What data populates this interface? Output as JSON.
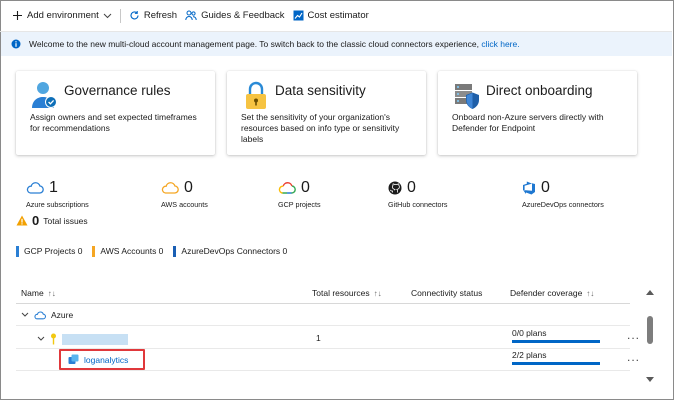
{
  "toolbar": {
    "add_environment": "Add environment",
    "refresh": "Refresh",
    "guides": "Guides & Feedback",
    "cost_estimator": "Cost estimator"
  },
  "banner": {
    "text": "Welcome to the new multi-cloud account management page. To switch back to the classic cloud connectors experience, ",
    "link": "click here."
  },
  "cards": [
    {
      "title": "Governance rules",
      "desc": "Assign owners and set expected timeframes for recommendations",
      "icon": "governance-person-icon"
    },
    {
      "title": "Data sensitivity",
      "desc": "Set the sensitivity of your organization's resources based on info type or sensitivity labels",
      "icon": "sensitivity-lock-icon"
    },
    {
      "title": "Direct onboarding",
      "desc": "Onboard non-Azure servers directly with Defender for Endpoint",
      "icon": "server-shield-icon"
    }
  ],
  "stats": [
    {
      "count": "1",
      "label": "Azure subscriptions",
      "icon": "azure-cloud-icon"
    },
    {
      "count": "0",
      "label": "AWS accounts",
      "icon": "aws-cloud-icon"
    },
    {
      "count": "0",
      "label": "GCP projects",
      "icon": "gcp-cloud-icon"
    },
    {
      "count": "0",
      "label": "GitHub connectors",
      "icon": "github-icon"
    },
    {
      "count": "0",
      "label": "AzureDevOps connectors",
      "icon": "azure-devops-icon"
    }
  ],
  "issues": {
    "count": "0",
    "label": "Total issues"
  },
  "chips": [
    {
      "label": "GCP Projects 0",
      "color": "#2a7fd4"
    },
    {
      "label": "AWS Accounts 0",
      "color": "#f5a623"
    },
    {
      "label": "AzureDevOps Connectors 0",
      "color": "#1a5fb4"
    }
  ],
  "table": {
    "headers": {
      "name": "Name",
      "total_resources": "Total resources",
      "connectivity": "Connectivity status",
      "defender": "Defender coverage"
    },
    "rows": [
      {
        "name": "Azure",
        "total": "",
        "plans": "",
        "plans_fraction": 0
      },
      {
        "name": "",
        "total": "1",
        "plans": "0/0 plans",
        "plans_fraction": 1
      },
      {
        "name": "loganalytics",
        "total": "",
        "plans": "2/2 plans",
        "plans_fraction": 1
      }
    ],
    "more_label": "..."
  },
  "colors": {
    "accent": "#0066c6",
    "banner_bg": "#ebf3fc",
    "highlight": "#e0383b",
    "redacted": "#c7e0f4"
  }
}
